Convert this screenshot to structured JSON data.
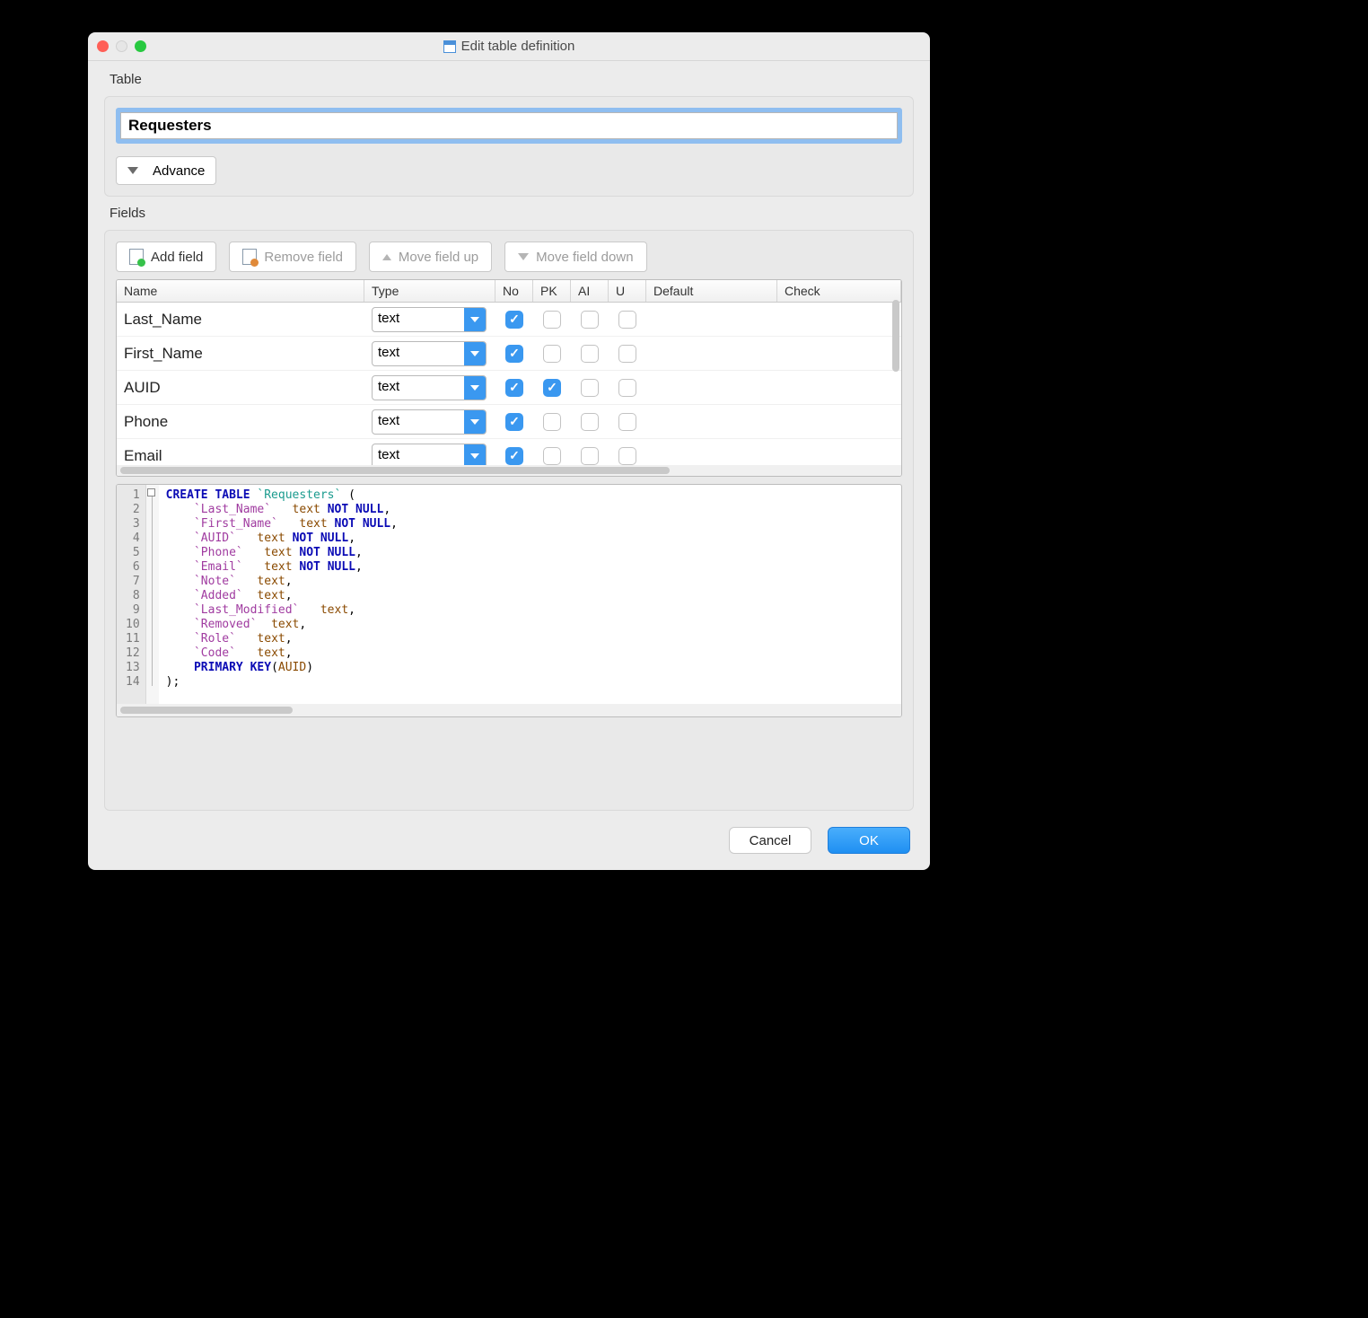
{
  "title": "Edit table definition",
  "table_section": {
    "label": "Table",
    "table_name": "Requesters",
    "advance_label": "Advance"
  },
  "fields_section": {
    "label": "Fields",
    "toolbar": {
      "add": "Add field",
      "remove": "Remove field",
      "move_up": "Move field up",
      "move_down": "Move field down"
    },
    "columns": {
      "name": "Name",
      "type": "Type",
      "no": "No",
      "pk": "PK",
      "ai": "AI",
      "u": "U",
      "default": "Default",
      "check": "Check"
    },
    "rows": [
      {
        "name": "Last_Name",
        "type": "text",
        "no": true,
        "pk": false,
        "ai": false,
        "u": false
      },
      {
        "name": "First_Name",
        "type": "text",
        "no": true,
        "pk": false,
        "ai": false,
        "u": false
      },
      {
        "name": "AUID",
        "type": "text",
        "no": true,
        "pk": true,
        "ai": false,
        "u": false
      },
      {
        "name": "Phone",
        "type": "text",
        "no": true,
        "pk": false,
        "ai": false,
        "u": false
      },
      {
        "name": "Email",
        "type": "text",
        "no": true,
        "pk": false,
        "ai": false,
        "u": false
      }
    ]
  },
  "sql": {
    "line_count": 14,
    "lines": [
      {
        "indent": 0,
        "tokens": [
          [
            "kw",
            "CREATE TABLE"
          ],
          [
            "sp",
            " "
          ],
          [
            "tn",
            "`Requesters`"
          ],
          [
            "sp",
            " ("
          ]
        ]
      },
      {
        "indent": 1,
        "tokens": [
          [
            "fn",
            "`Last_Name`"
          ],
          [
            "sp",
            "   "
          ],
          [
            "tp",
            "text"
          ],
          [
            "sp",
            " "
          ],
          [
            "kw",
            "NOT NULL"
          ],
          [
            "sp",
            ","
          ]
        ]
      },
      {
        "indent": 1,
        "tokens": [
          [
            "fn",
            "`First_Name`"
          ],
          [
            "sp",
            "   "
          ],
          [
            "tp",
            "text"
          ],
          [
            "sp",
            " "
          ],
          [
            "kw",
            "NOT NULL"
          ],
          [
            "sp",
            ","
          ]
        ]
      },
      {
        "indent": 1,
        "tokens": [
          [
            "fn",
            "`AUID`"
          ],
          [
            "sp",
            "   "
          ],
          [
            "tp",
            "text"
          ],
          [
            "sp",
            " "
          ],
          [
            "kw",
            "NOT NULL"
          ],
          [
            "sp",
            ","
          ]
        ]
      },
      {
        "indent": 1,
        "tokens": [
          [
            "fn",
            "`Phone`"
          ],
          [
            "sp",
            "   "
          ],
          [
            "tp",
            "text"
          ],
          [
            "sp",
            " "
          ],
          [
            "kw",
            "NOT NULL"
          ],
          [
            "sp",
            ","
          ]
        ]
      },
      {
        "indent": 1,
        "tokens": [
          [
            "fn",
            "`Email`"
          ],
          [
            "sp",
            "   "
          ],
          [
            "tp",
            "text"
          ],
          [
            "sp",
            " "
          ],
          [
            "kw",
            "NOT NULL"
          ],
          [
            "sp",
            ","
          ]
        ]
      },
      {
        "indent": 1,
        "tokens": [
          [
            "fn",
            "`Note`"
          ],
          [
            "sp",
            "   "
          ],
          [
            "tp",
            "text"
          ],
          [
            "sp",
            ","
          ]
        ]
      },
      {
        "indent": 1,
        "tokens": [
          [
            "fn",
            "`Added`"
          ],
          [
            "sp",
            "  "
          ],
          [
            "tp",
            "text"
          ],
          [
            "sp",
            ","
          ]
        ]
      },
      {
        "indent": 1,
        "tokens": [
          [
            "fn",
            "`Last_Modified`"
          ],
          [
            "sp",
            "   "
          ],
          [
            "tp",
            "text"
          ],
          [
            "sp",
            ","
          ]
        ]
      },
      {
        "indent": 1,
        "tokens": [
          [
            "fn",
            "`Removed`"
          ],
          [
            "sp",
            "  "
          ],
          [
            "tp",
            "text"
          ],
          [
            "sp",
            ","
          ]
        ]
      },
      {
        "indent": 1,
        "tokens": [
          [
            "fn",
            "`Role`"
          ],
          [
            "sp",
            "   "
          ],
          [
            "tp",
            "text"
          ],
          [
            "sp",
            ","
          ]
        ]
      },
      {
        "indent": 1,
        "tokens": [
          [
            "fn",
            "`Code`"
          ],
          [
            "sp",
            "   "
          ],
          [
            "tp",
            "text"
          ],
          [
            "sp",
            ","
          ]
        ]
      },
      {
        "indent": 1,
        "tokens": [
          [
            "kw",
            "PRIMARY KEY"
          ],
          [
            "sp",
            "("
          ],
          [
            "tp",
            "AUID"
          ],
          [
            "sp",
            ")"
          ]
        ]
      },
      {
        "indent": 0,
        "tokens": [
          [
            "sp",
            ");"
          ]
        ]
      }
    ]
  },
  "footer": {
    "cancel": "Cancel",
    "ok": "OK"
  }
}
